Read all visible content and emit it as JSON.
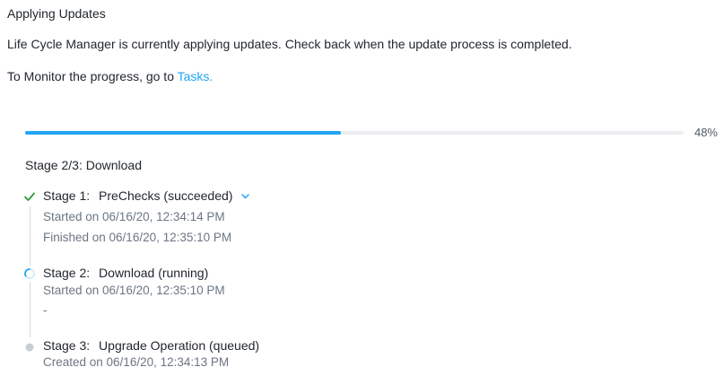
{
  "header": {
    "title": "Applying Updates",
    "message": "Life Cycle Manager is currently applying updates. Check back when the update process is completed.",
    "monitor_prefix": "To Monitor the progress, go to ",
    "monitor_link": "Tasks."
  },
  "progress": {
    "percent": 48,
    "label": "48%",
    "color": "#22a5f7"
  },
  "stage_summary": "Stage 2/3: Download",
  "stages": [
    {
      "number": "Stage 1:",
      "name": "PreChecks (succeeded)",
      "status": "succeeded",
      "icon": "check-icon",
      "details": [
        "Started on 06/16/20, 12:34:14 PM",
        "Finished on 06/16/20, 12:35:10 PM"
      ]
    },
    {
      "number": "Stage 2:",
      "name": "Download (running)",
      "status": "running",
      "icon": "spinner-icon",
      "details": [
        "Started on 06/16/20, 12:35:10 PM",
        "-"
      ]
    },
    {
      "number": "Stage 3:",
      "name": "Upgrade Operation (queued)",
      "status": "queued",
      "icon": "dot-icon",
      "details": [
        "Created on 06/16/20, 12:34:13 PM"
      ]
    }
  ],
  "colors": {
    "accent": "#22a5f7",
    "success": "#2a9d3a",
    "queued": "#c9ced4"
  }
}
